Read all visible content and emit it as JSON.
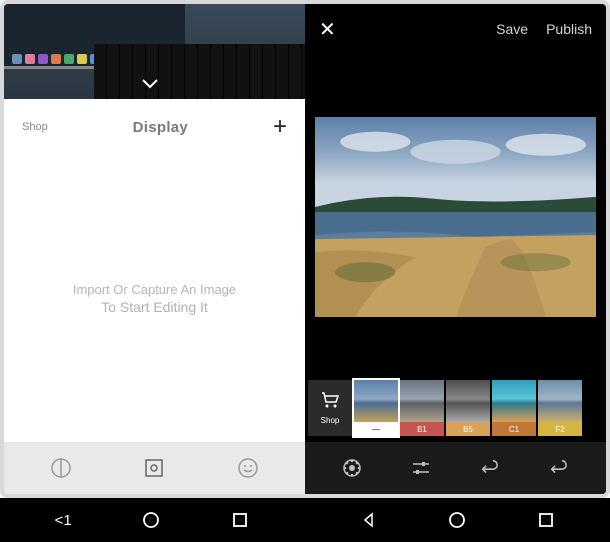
{
  "left": {
    "shop_label": "Shop",
    "display_label": "Display",
    "plus_glyph": "+",
    "import_line1": "Import Or Capture An Image",
    "import_line2": "To Start Editing It"
  },
  "right": {
    "close_glyph": "✕",
    "save_label": "Save",
    "publish_label": "Publish",
    "filters": {
      "shop_label": "Shop",
      "items": [
        {
          "label": "—",
          "bg": "#ffffff",
          "selected": true
        },
        {
          "label": "B1",
          "bg": "#c9554f"
        },
        {
          "label": "B5",
          "bg": "#d9a15a"
        },
        {
          "label": "C1",
          "bg": "#c07839"
        },
        {
          "label": "F2",
          "bg": "#d7b640"
        }
      ]
    }
  },
  "nav": {
    "left_back": "<1"
  },
  "colors": {
    "sky_top": "#5b7fa8",
    "sky_mid": "#8fa8c4",
    "water": "#4a6e8f",
    "grass": "#c4a15e",
    "hills": "#2c4a38"
  }
}
